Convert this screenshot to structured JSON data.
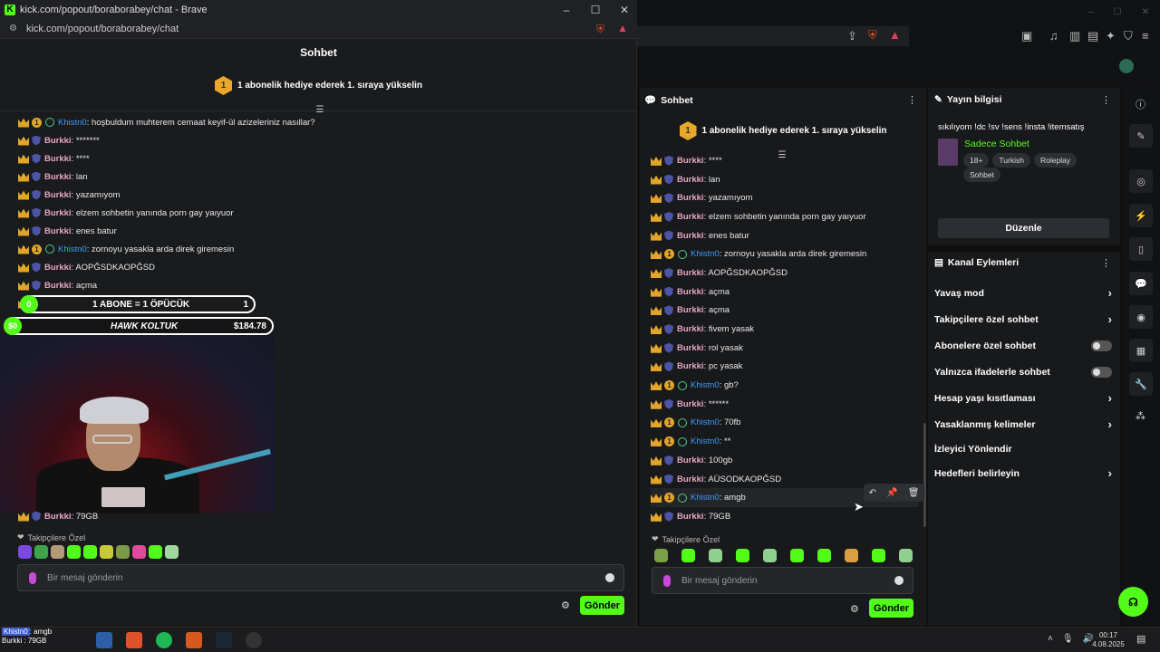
{
  "popup": {
    "window_title": "kick.com/popout/boraborabey/chat - Brave",
    "url": "kick.com/popout/boraborabey/chat",
    "chat_title": "Sohbet",
    "banner_rank": "1",
    "banner_text": "1 abonelik hediye ederek 1. sıraya yükselin",
    "messages": [
      {
        "badges": "crown-sub-gem",
        "user": "Khistn0",
        "text": ": hoşbuldum muhterem cemaat keyif-ül azizeleriniz nasıllar?",
        "type": "k"
      },
      {
        "badges": "crown-shield",
        "user": "Burkki",
        "text": ": *******",
        "type": "b"
      },
      {
        "badges": "crown-shield",
        "user": "Burkki",
        "text": ": ****",
        "type": "b"
      },
      {
        "badges": "crown-shield",
        "user": "Burkki",
        "text": ": lan",
        "type": "b"
      },
      {
        "badges": "crown-shield",
        "user": "Burkki",
        "text": ": yazamıyom",
        "type": "b"
      },
      {
        "badges": "crown-shield",
        "user": "Burkki",
        "text": ": elzem sohbetin yanında porn gay yaıyuor",
        "type": "b"
      },
      {
        "badges": "crown-shield",
        "user": "Burkki",
        "text": ": enes batur",
        "type": "b"
      },
      {
        "badges": "crown-sub-gem",
        "user": "Khistn0",
        "text": ": zornoyu yasakla arda direk giremesin",
        "type": "k"
      },
      {
        "badges": "crown-shield",
        "user": "Burkki",
        "text": ": AOPĞSDKAOPĞSD",
        "type": "b"
      },
      {
        "badges": "crown-shield",
        "user": "Burkki",
        "text": ": açma",
        "type": "b"
      },
      {
        "badges": "crown-shield",
        "user": "Burkki",
        "text": ": açma",
        "type": "b"
      },
      {
        "badges": "crown-shield",
        "user": "Burkki",
        "text": ": fivem yasak",
        "type": "b"
      }
    ],
    "overlay_goal_count": "0",
    "overlay_goal_text": "1 ABONE = 1 ÖPÜCÜK",
    "overlay_goal_target": "1",
    "overlay_donation_amount": "$0",
    "overlay_donation_text": "HAWK KOLTUK",
    "overlay_donation_goal": "$184.78",
    "last_message_user": "Burkki",
    "last_message_text": ": 79GB",
    "followers_label": "Takipçilere Özel",
    "input_placeholder": "Bir mesaj gönderin",
    "send_label": "Gönder"
  },
  "main_chat": {
    "title": "Sohbet",
    "banner_rank": "1",
    "banner_text": "1 abonelik hediye ederek 1. sıraya yükselin",
    "messages": [
      {
        "user": "Burkki",
        "text": ": ****",
        "type": "b"
      },
      {
        "user": "Burkki",
        "text": ": lan",
        "type": "b"
      },
      {
        "user": "Burkki",
        "text": ": yazamıyom",
        "type": "b"
      },
      {
        "user": "Burkki",
        "text": ": elzem sohbetin yanında porn gay yaıyuor",
        "type": "b"
      },
      {
        "user": "Burkki",
        "text": ": enes batur",
        "type": "b"
      },
      {
        "user": "Khistn0",
        "text": ": zornoyu yasakla arda direk giremesin",
        "type": "k"
      },
      {
        "user": "Burkki",
        "text": ": AOPĞSDKAOPĞSD",
        "type": "b"
      },
      {
        "user": "Burkki",
        "text": ": açma",
        "type": "b"
      },
      {
        "user": "Burkki",
        "text": ": açma",
        "type": "b"
      },
      {
        "user": "Burkki",
        "text": ": fivem yasak",
        "type": "b"
      },
      {
        "user": "Burkki",
        "text": ": rol yasak",
        "type": "b"
      },
      {
        "user": "Burkki",
        "text": ": pc yasak",
        "type": "b"
      },
      {
        "user": "Khistn0",
        "text": ": gb?",
        "type": "k"
      },
      {
        "user": "Burkki",
        "text": ": ******",
        "type": "b"
      },
      {
        "user": "Khistn0",
        "text": ": 70fb",
        "type": "k"
      },
      {
        "user": "Khistn0",
        "text": ": **",
        "type": "k"
      },
      {
        "user": "Burkki",
        "text": ": 100gb",
        "type": "b"
      },
      {
        "user": "Burkki",
        "text": ": AÜSODKAOPĞSD",
        "type": "b"
      },
      {
        "user": "Khistn0",
        "text": ": amgb",
        "type": "k"
      },
      {
        "user": "Burkki",
        "text": ": 79GB",
        "type": "b"
      }
    ],
    "followers_label": "Takipçilere Özel",
    "input_placeholder": "Bir mesaj gönderin",
    "send_label": "Gönder"
  },
  "stream_info": {
    "title": "Yayın bilgisi",
    "stream_title": "sıkılıyom !dc !sv !sens !insta !itemsatış",
    "category": "Sadece Sohbet",
    "tags": [
      "18+",
      "Turkish",
      "Roleplay",
      "Sohbet"
    ],
    "edit_label": "Düzenle"
  },
  "channel_actions": {
    "title": "Kanal Eylemleri",
    "items": [
      {
        "label": "Yavaş mod",
        "control": "chevron"
      },
      {
        "label": "Takipçilere özel sohbet",
        "control": "chevron"
      },
      {
        "label": "Abonelere özel sohbet",
        "control": "toggle"
      },
      {
        "label": "Yalnızca ifadelerle sohbet",
        "control": "toggle"
      },
      {
        "label": "Hesap yaşı kısıtlaması",
        "control": "chevron"
      },
      {
        "label": "Yasaklanmış kelimeler",
        "control": "chevron"
      },
      {
        "label": "İzleyici Yönlendir",
        "control": "none"
      },
      {
        "label": "Hedefleri belirleyin",
        "control": "chevron"
      }
    ]
  },
  "taskbar": {
    "notif_user": "Khistn0",
    "notif_text": "amgb",
    "notif2": "Burkki : 79GB",
    "time": "00:17",
    "date": "4.08.2025"
  },
  "colors": {
    "kick_green": "#53fc18",
    "burkki": "#e6a6c4",
    "khistn0": "#3b9cff",
    "crown": "#e0a52a"
  }
}
